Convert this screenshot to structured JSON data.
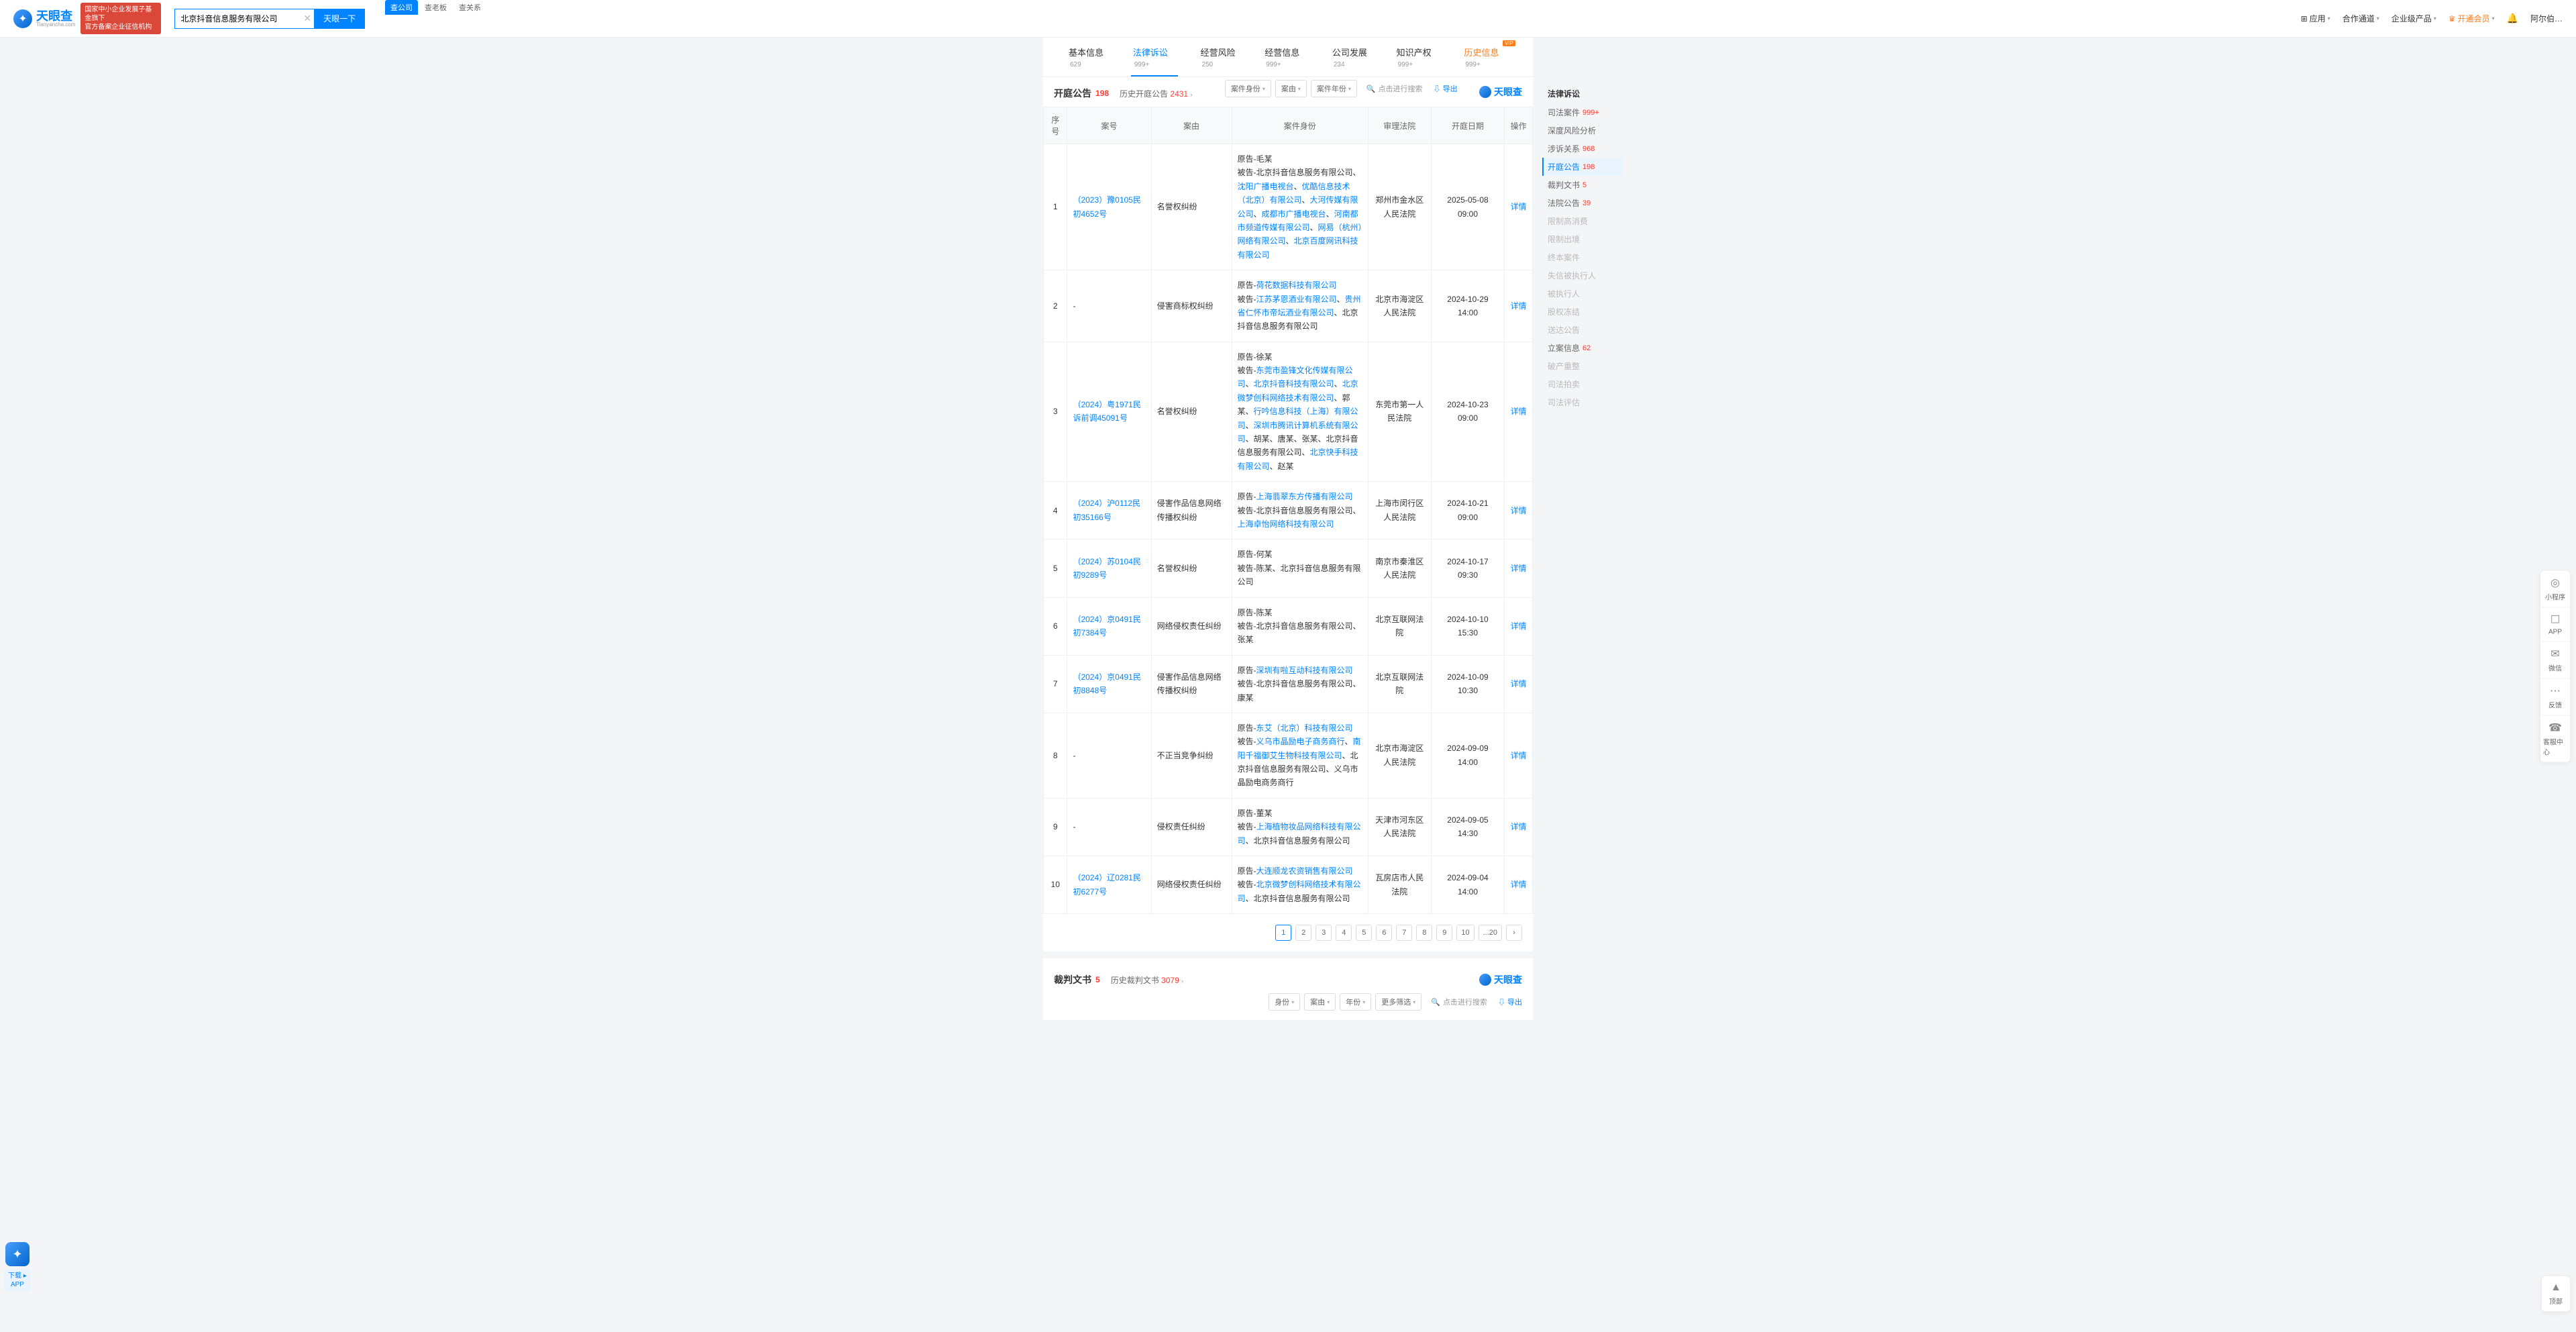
{
  "header": {
    "logo_cn": "天眼查",
    "logo_en": "Tianyancha.com",
    "banner_l1": "国家中小企业发展子基金旗下",
    "banner_l2": "官方备案企业征信机构",
    "search_tabs": [
      "查公司",
      "查老板",
      "查关系"
    ],
    "search_value": "北京抖音信息服务有限公司",
    "search_btn": "天眼一下",
    "right": {
      "app": "应用",
      "coop": "合作通道",
      "ent": "企业级产品",
      "vip": "开通会员",
      "user": "阿尔伯…"
    }
  },
  "main_tabs": [
    {
      "label": "基本信息",
      "count": "629"
    },
    {
      "label": "法律诉讼",
      "count": "999+",
      "active": true
    },
    {
      "label": "经营风险",
      "count": "250"
    },
    {
      "label": "经营信息",
      "count": "999+"
    },
    {
      "label": "公司发展",
      "count": "234"
    },
    {
      "label": "知识产权",
      "count": "999+"
    },
    {
      "label": "历史信息",
      "count": "999+",
      "hist": true,
      "hot": "VIP"
    }
  ],
  "right_nav": {
    "title": "法律诉讼",
    "items": [
      {
        "label": "司法案件",
        "count": "999+"
      },
      {
        "label": "深度风险分析"
      },
      {
        "label": "涉诉关系",
        "count": "968"
      },
      {
        "label": "开庭公告",
        "count": "198",
        "active": true
      },
      {
        "label": "裁判文书",
        "count": "5"
      },
      {
        "label": "法院公告",
        "count": "39"
      },
      {
        "label": "限制高消费",
        "muted": true
      },
      {
        "label": "限制出境",
        "muted": true
      },
      {
        "label": "终本案件",
        "muted": true
      },
      {
        "label": "失信被执行人",
        "muted": true
      },
      {
        "label": "被执行人",
        "muted": true
      },
      {
        "label": "股权冻结",
        "muted": true
      },
      {
        "label": "送达公告",
        "muted": true
      },
      {
        "label": "立案信息",
        "count": "62"
      },
      {
        "label": "破产重整",
        "muted": true
      },
      {
        "label": "司法拍卖",
        "muted": true
      },
      {
        "label": "司法评估",
        "muted": true
      }
    ]
  },
  "section1": {
    "title": "开庭公告",
    "count": "198",
    "hist_label": "历史开庭公告",
    "hist_count": "2431",
    "filters": [
      "案件身份",
      "案由",
      "案件年份"
    ],
    "search_hint": "点击进行搜索",
    "export": "导出",
    "brand": "天眼查",
    "columns": [
      "序号",
      "案号",
      "案由",
      "案件身份",
      "审理法院",
      "开庭日期",
      "操作"
    ],
    "op_label": "详情",
    "plaintiff_lbl": "原告-",
    "defendant_lbl": "被告-",
    "rows": [
      {
        "idx": 1,
        "case_no": "（2023）豫0105民初4652号",
        "cause": "名誉权纠纷",
        "plaintiff": [
          {
            "t": "毛某"
          }
        ],
        "defendant": [
          {
            "t": "北京抖音信息服务有限公司"
          },
          {
            "t": "、"
          },
          {
            "t": "沈阳广播电视台",
            "l": 1
          },
          {
            "t": "、"
          },
          {
            "t": "优酷信息技术（北京）有限公司",
            "l": 1
          },
          {
            "t": "、"
          },
          {
            "t": "大河传媒有限公司",
            "l": 1
          },
          {
            "t": "、"
          },
          {
            "t": "成都市广播电视台",
            "l": 1
          },
          {
            "t": "、"
          },
          {
            "t": "河南都市频道传媒有限公司",
            "l": 1
          },
          {
            "t": "、"
          },
          {
            "t": "网易（杭州）网络有限公司",
            "l": 1
          },
          {
            "t": "、"
          },
          {
            "t": "北京百度网讯科技有限公司",
            "l": 1
          }
        ],
        "court": "郑州市金水区人民法院",
        "date": "2025-05-08 09:00"
      },
      {
        "idx": 2,
        "case_no": "-",
        "cause": "侵害商标权纠纷",
        "plaintiff": [
          {
            "t": "荷花数据科技有限公司",
            "l": 1
          }
        ],
        "defendant": [
          {
            "t": "江苏茅恩酒业有限公司",
            "l": 1
          },
          {
            "t": "、"
          },
          {
            "t": "贵州省仁怀市帝坛酒业有限公司",
            "l": 1
          },
          {
            "t": "、北京抖音信息服务有限公司"
          }
        ],
        "court": "北京市海淀区人民法院",
        "date": "2024-10-29 14:00"
      },
      {
        "idx": 3,
        "case_no": "（2024）粤1971民诉前调45091号",
        "cause": "名誉权纠纷",
        "plaintiff": [
          {
            "t": "徐某"
          }
        ],
        "defendant": [
          {
            "t": "东莞市盈锋文化传媒有限公司",
            "l": 1
          },
          {
            "t": "、"
          },
          {
            "t": "北京抖音科技有限公司",
            "l": 1
          },
          {
            "t": "、"
          },
          {
            "t": "北京微梦创科网络技术有限公司",
            "l": 1
          },
          {
            "t": "、郭某、"
          },
          {
            "t": "行吟信息科技（上海）有限公司",
            "l": 1
          },
          {
            "t": "、"
          },
          {
            "t": "深圳市腾讯计算机系统有限公司",
            "l": 1
          },
          {
            "t": "、胡某、唐某、张某、北京抖音信息服务有限公司、"
          },
          {
            "t": "北京快手科技有限公司",
            "l": 1
          },
          {
            "t": "、赵某"
          }
        ],
        "court": "东莞市第一人民法院",
        "date": "2024-10-23 09:00"
      },
      {
        "idx": 4,
        "case_no": "（2024）沪0112民初35166号",
        "cause": "侵害作品信息网络传播权纠纷",
        "plaintiff": [
          {
            "t": "上海翡翠东方传播有限公司",
            "l": 1
          }
        ],
        "defendant": [
          {
            "t": "北京抖音信息服务有限公司、"
          },
          {
            "t": "上海卓怡网络科技有限公司",
            "l": 1
          }
        ],
        "court": "上海市闵行区人民法院",
        "date": "2024-10-21 09:00"
      },
      {
        "idx": 5,
        "case_no": "（2024）苏0104民初9289号",
        "cause": "名誉权纠纷",
        "plaintiff": [
          {
            "t": "何某"
          }
        ],
        "defendant": [
          {
            "t": "陈某、北京抖音信息服务有限公司"
          }
        ],
        "court": "南京市秦淮区人民法院",
        "date": "2024-10-17 09:30"
      },
      {
        "idx": 6,
        "case_no": "（2024）京0491民初7384号",
        "cause": "网络侵权责任纠纷",
        "plaintiff": [
          {
            "t": "陈某"
          }
        ],
        "defendant": [
          {
            "t": "北京抖音信息服务有限公司、张某"
          }
        ],
        "court": "北京互联网法院",
        "date": "2024-10-10 15:30"
      },
      {
        "idx": 7,
        "case_no": "（2024）京0491民初8848号",
        "cause": "侵害作品信息网络传播权纠纷",
        "plaintiff": [
          {
            "t": "深圳有啦互动科技有限公司",
            "l": 1
          }
        ],
        "defendant": [
          {
            "t": "北京抖音信息服务有限公司、康某"
          }
        ],
        "court": "北京互联网法院",
        "date": "2024-10-09 10:30"
      },
      {
        "idx": 8,
        "case_no": "-",
        "cause": "不正当竞争纠纷",
        "plaintiff": [
          {
            "t": "东艾（北京）科技有限公司",
            "l": 1
          }
        ],
        "defendant": [
          {
            "t": "义乌市晶励电子商务商行",
            "l": 1
          },
          {
            "t": "、"
          },
          {
            "t": "南阳千福御艾生物科技有限公司",
            "l": 1
          },
          {
            "t": "、北京抖音信息服务有限公司、义乌市晶励电商务商行"
          }
        ],
        "court": "北京市海淀区人民法院",
        "date": "2024-09-09 14:00"
      },
      {
        "idx": 9,
        "case_no": "-",
        "cause": "侵权责任纠纷",
        "plaintiff": [
          {
            "t": "董某"
          }
        ],
        "defendant": [
          {
            "t": "上海植物妆品网络科技有限公司",
            "l": 1
          },
          {
            "t": "、北京抖音信息服务有限公司"
          }
        ],
        "court": "天津市河东区人民法院",
        "date": "2024-09-05 14:30"
      },
      {
        "idx": 10,
        "case_no": "（2024）辽0281民初6277号",
        "cause": "网络侵权责任纠纷",
        "plaintiff": [
          {
            "t": "大连顺龙农资销售有限公司",
            "l": 1
          }
        ],
        "defendant": [
          {
            "t": "北京微梦创科网络技术有限公司",
            "l": 1
          },
          {
            "t": "、北京抖音信息服务有限公司"
          }
        ],
        "court": "瓦房店市人民法院",
        "date": "2024-09-04 14:00"
      }
    ],
    "pagination": [
      "1",
      "2",
      "3",
      "4",
      "5",
      "6",
      "7",
      "8",
      "9",
      "10",
      "...20",
      "›"
    ]
  },
  "section2": {
    "title": "裁判文书",
    "count": "5",
    "hist_label": "历史裁判文书",
    "hist_count": "3079",
    "filters": [
      "身份",
      "案由",
      "年份",
      "更多筛选"
    ],
    "search_hint": "点击进行搜索",
    "export": "导出",
    "brand": "天眼查"
  },
  "float_right": [
    {
      "icon": "◎",
      "label": "小程序"
    },
    {
      "icon": "☐",
      "label": "APP"
    },
    {
      "icon": "✉",
      "label": "微信"
    },
    {
      "icon": "⋯",
      "label": "反馈"
    },
    {
      "icon": "☎",
      "label": "客服中心"
    }
  ],
  "float_top": {
    "icon": "▲",
    "label": "顶部"
  },
  "float_left": {
    "l1": "下载",
    "l2": "APP"
  }
}
